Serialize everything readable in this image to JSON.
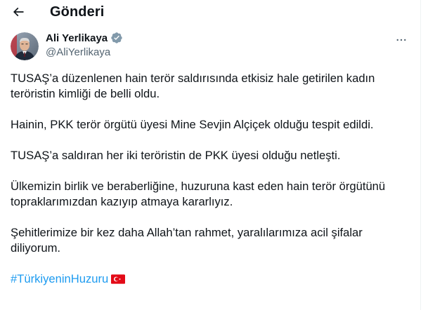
{
  "header": {
    "title": "Gönderi",
    "back_icon": "arrow-left-icon"
  },
  "author": {
    "display_name": "Ali Yerlikaya",
    "handle": "@AliYerlikaya",
    "verified": true,
    "verified_color": "#829aab"
  },
  "tweet": {
    "paragraphs": [
      "TUSAŞ’a düzenlenen hain terör saldırısında etkisiz hale getirilen kadın teröristin kimliği de belli oldu.",
      "Hainin, PKK terör örgütü üyesi Mine Sevjin Alçiçek olduğu tespit edildi.",
      "TUSAŞ’a saldıran her iki teröristin de PKK üyesi olduğu netleşti.",
      "Ülkemizin birlik ve beraberliğine, huzuruna kast eden hain terör örgütünü topraklarımızdan kazıyıp atmaya kararlıyız.",
      "Şehitlerimize bir kez daha Allah’tan rahmet, yaralılarımıza acil şifalar diliyorum."
    ],
    "hashtag": "#TürkiyeninHuzuru",
    "emoji": "turkey-flag-icon"
  },
  "colors": {
    "text": "#0f1419",
    "muted": "#536471",
    "link": "#1d9bf0",
    "flag_red": "#e30a17"
  }
}
